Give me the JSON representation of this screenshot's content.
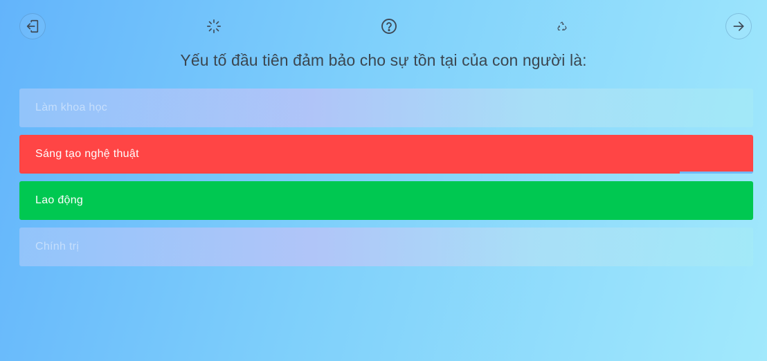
{
  "toolbar": {
    "exit_icon": "exit-icon",
    "loading_icon": "loading-spinner-icon",
    "help_icon": "question-circle-icon",
    "recycle_icon": "recycle-icon",
    "next_icon": "arrow-right-icon"
  },
  "question": {
    "text": "Yếu tố đầu tiên đảm bảo cho sự tồn tại của con người là:"
  },
  "answers": [
    {
      "label": "Làm khoa học",
      "state": "faded"
    },
    {
      "label": "Sáng tạo nghệ thuật",
      "state": "wrong"
    },
    {
      "label": "Lao động",
      "state": "correct"
    },
    {
      "label": "Chính trị",
      "state": "faded"
    }
  ],
  "colors": {
    "wrong": "#ff4545",
    "correct": "#00c851",
    "text_dark": "#3b4650"
  }
}
